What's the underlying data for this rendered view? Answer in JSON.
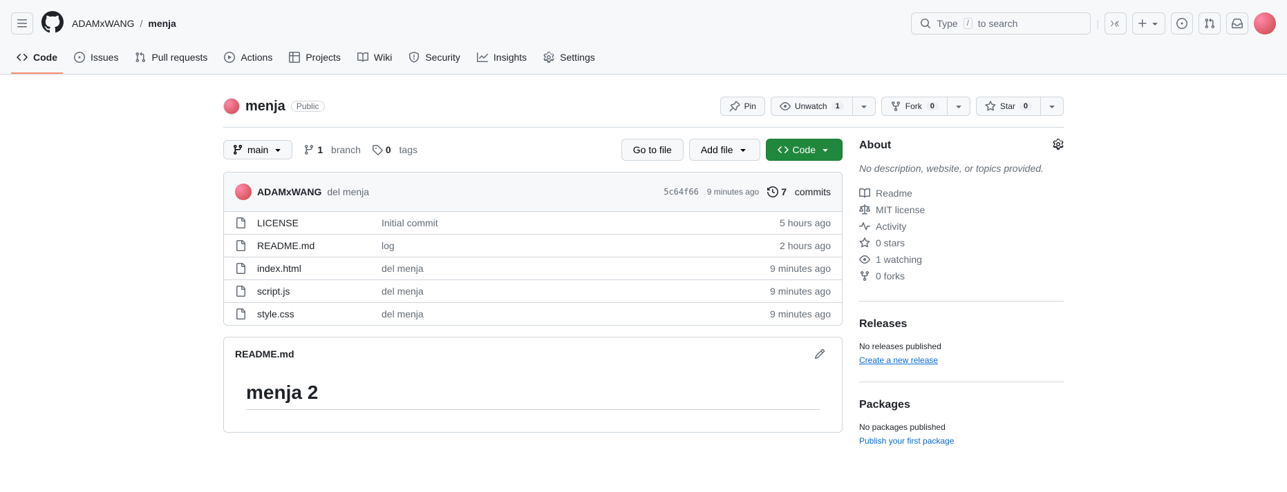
{
  "header": {
    "owner": "ADAMxWANG",
    "repo": "menja",
    "search_prefix": "Type",
    "search_key": "/",
    "search_suffix": "to search"
  },
  "tabs": {
    "code": "Code",
    "issues": "Issues",
    "pulls": "Pull requests",
    "actions": "Actions",
    "projects": "Projects",
    "wiki": "Wiki",
    "security": "Security",
    "insights": "Insights",
    "settings": "Settings"
  },
  "repo": {
    "name": "menja",
    "visibility": "Public",
    "actions": {
      "pin": "Pin",
      "unwatch": "Unwatch",
      "watch_count": "1",
      "fork": "Fork",
      "fork_count": "0",
      "star": "Star",
      "star_count": "0"
    }
  },
  "filebar": {
    "branch": "main",
    "branches_n": "1",
    "branches_label": "branch",
    "tags_n": "0",
    "tags_label": "tags",
    "go_to_file": "Go to file",
    "add_file": "Add file",
    "code_btn": "Code"
  },
  "latest_commit": {
    "author": "ADAMxWANG",
    "message": "del menja",
    "hash": "5c64f66",
    "time": "9 minutes ago",
    "commits_n": "7",
    "commits_label": "commits"
  },
  "files": [
    {
      "name": "LICENSE",
      "msg": "Initial commit",
      "time": "5 hours ago"
    },
    {
      "name": "README.md",
      "msg": "log",
      "time": "2 hours ago"
    },
    {
      "name": "index.html",
      "msg": "del menja",
      "time": "9 minutes ago"
    },
    {
      "name": "script.js",
      "msg": "del menja",
      "time": "9 minutes ago"
    },
    {
      "name": "style.css",
      "msg": "del menja",
      "time": "9 minutes ago"
    }
  ],
  "readme": {
    "filename": "README.md",
    "heading": "menja 2"
  },
  "sidebar": {
    "about": "About",
    "description": "No description, website, or topics provided.",
    "readme": "Readme",
    "license": "MIT license",
    "activity": "Activity",
    "stars": "0 stars",
    "watching": "1 watching",
    "forks": "0 forks",
    "releases": "Releases",
    "no_releases": "No releases published",
    "create_release": "Create a new release",
    "packages": "Packages",
    "no_packages": "No packages published",
    "publish_package": "Publish your first package"
  }
}
